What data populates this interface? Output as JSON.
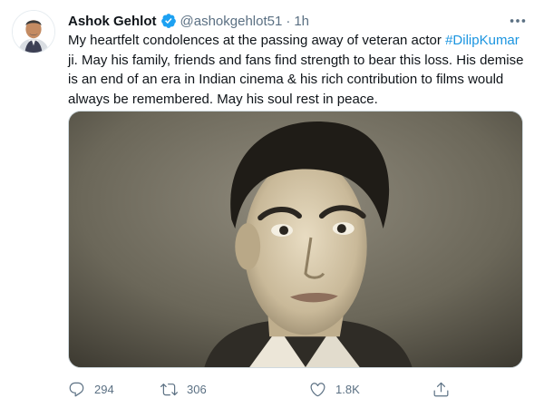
{
  "tweet": {
    "author_name": "Ashok Gehlot",
    "handle": "@ashokgehlot51",
    "separator": "·",
    "time": "1h",
    "text_before": "My heartfelt condolences at the passing away of veteran actor ",
    "hashtag": "#DilipKumar",
    "text_after": " ji. May his family, friends and fans find strength to bear this loss. His demise is an end of an era in Indian cinema & his rich contribution to films would always be remembered. May his soul rest in peace."
  },
  "actions": {
    "replies": "294",
    "retweets": "306",
    "likes": "1.8K"
  },
  "colors": {
    "accent": "#1b95e0",
    "secondary_text": "#5b7083",
    "verified_badge": "#1da1f2"
  },
  "icons": {
    "verified": "verified-badge-icon",
    "more": "more-options-icon",
    "reply": "reply-icon",
    "retweet": "retweet-icon",
    "like": "heart-icon",
    "share": "share-icon"
  }
}
